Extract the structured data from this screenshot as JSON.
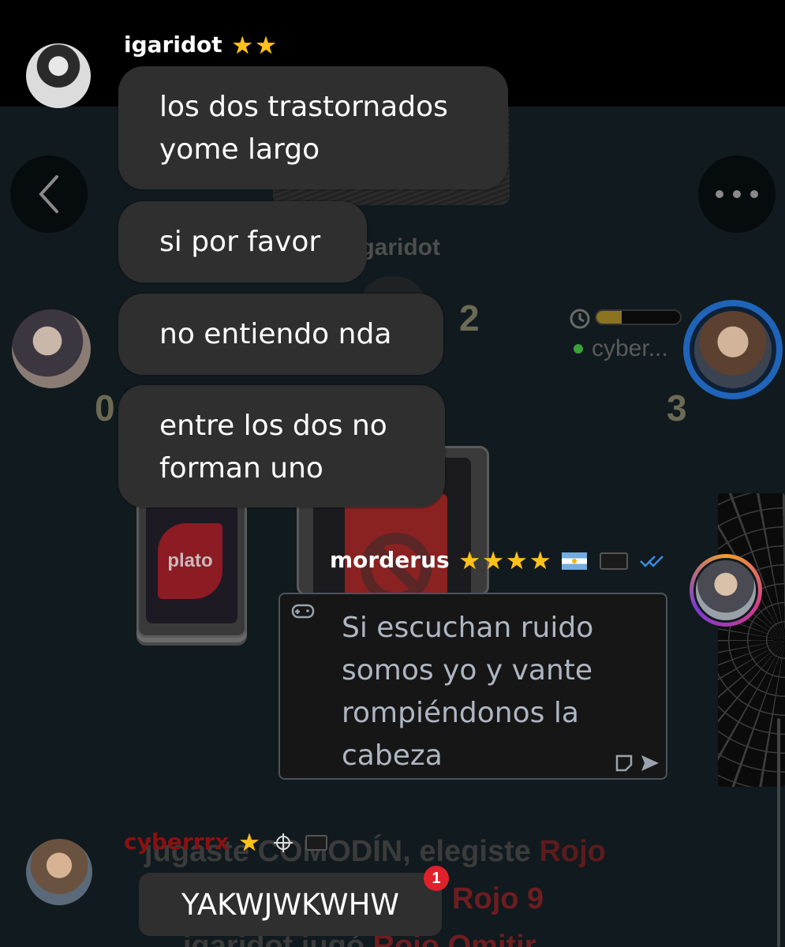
{
  "game": {
    "top_player_name": "igaridot",
    "top_player_count": "2",
    "left_player_count": "0",
    "right_player_name": "cyber...",
    "right_player_count": "3",
    "card_logo": "plato",
    "timer_progress": 0.3
  },
  "chat": {
    "igaridot": {
      "username": "igaridot",
      "stars": 2,
      "messages": [
        [
          "los dos trastornados",
          "yome largo"
        ],
        [
          "si por favor"
        ],
        [
          "no entiendo nda"
        ],
        [
          "entre los dos no",
          "forman uno"
        ]
      ]
    },
    "morderus": {
      "username": "morderus",
      "stars": 4,
      "message": [
        "Si escuchan ruido",
        "somos yo y vante",
        "rompiéndonos la",
        "cabeza"
      ]
    },
    "cyberrrx": {
      "username": "cyberrrx",
      "stars": 1,
      "message": "YAKWJWKWHW",
      "badge": "1"
    }
  },
  "game_log": {
    "line1_prefix": "jugaste COMODÍN, elegiste ",
    "line1_color": "Rojo",
    "line2": "Rojo 9",
    "line3_prefix": "igaridot jugó ",
    "line3_color": "Rojo Omitir"
  },
  "icons": [
    "back-icon",
    "more-icon",
    "clock-icon",
    "gamepad-icon",
    "sticker-icon",
    "send-icon",
    "target-icon",
    "double-check-icon"
  ],
  "colors": {
    "accent_blue": "#1f64b8",
    "red_text": "#5e1a1c",
    "star": "#ffc21a",
    "online": "#3aa03a"
  }
}
